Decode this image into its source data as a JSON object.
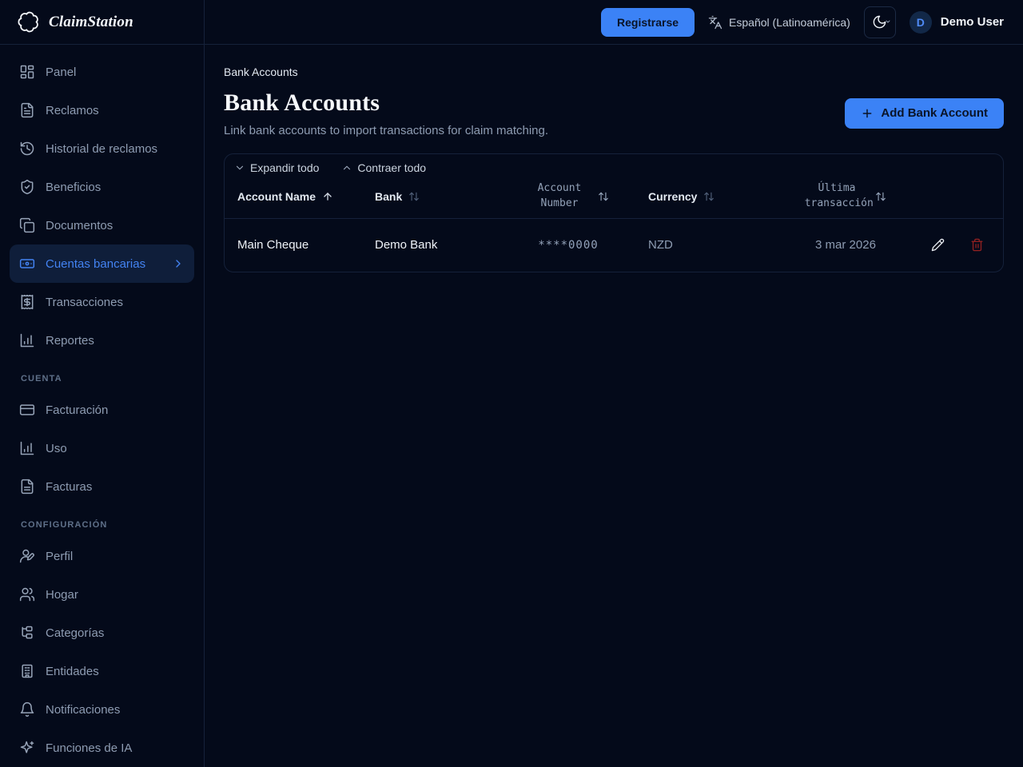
{
  "brand": {
    "name": "ClaimStation"
  },
  "topbar": {
    "register_label": "Registrarse",
    "language": "Español (Latinoamérica)",
    "user": {
      "initial": "D",
      "name": "Demo User"
    }
  },
  "sidebar": {
    "main": [
      {
        "label": "Panel"
      },
      {
        "label": "Reclamos"
      },
      {
        "label": "Historial de reclamos"
      },
      {
        "label": "Beneficios"
      },
      {
        "label": "Documentos"
      },
      {
        "label": "Cuentas bancarias"
      },
      {
        "label": "Transacciones"
      },
      {
        "label": "Reportes"
      }
    ],
    "sections": [
      {
        "title": "CUENTA",
        "items": [
          {
            "label": "Facturación"
          },
          {
            "label": "Uso"
          },
          {
            "label": "Facturas"
          }
        ]
      },
      {
        "title": "CONFIGURACIÓN",
        "items": [
          {
            "label": "Perfil"
          },
          {
            "label": "Hogar"
          },
          {
            "label": "Categorías"
          },
          {
            "label": "Entidades"
          },
          {
            "label": "Notificaciones"
          },
          {
            "label": "Funciones de IA"
          }
        ]
      }
    ]
  },
  "page": {
    "breadcrumb": "Bank Accounts",
    "title": "Bank Accounts",
    "subtitle": "Link bank accounts to import transactions for claim matching.",
    "add_button_label": "Add Bank Account",
    "expand_all_label": "Expandir todo",
    "collapse_all_label": "Contraer todo",
    "table": {
      "columns": [
        "Account Name",
        "Bank",
        "Account Number",
        "Currency",
        "Última transacción"
      ],
      "rows": [
        {
          "account_name": "Main Cheque",
          "bank": "Demo Bank",
          "account_number": "****0000",
          "currency": "NZD",
          "last_transaction": "3 mar 2026"
        }
      ]
    }
  },
  "colors": {
    "accent": "#3b82f6",
    "danger": "#962121",
    "background": "#040a1a",
    "active_link": "#4383f2"
  }
}
